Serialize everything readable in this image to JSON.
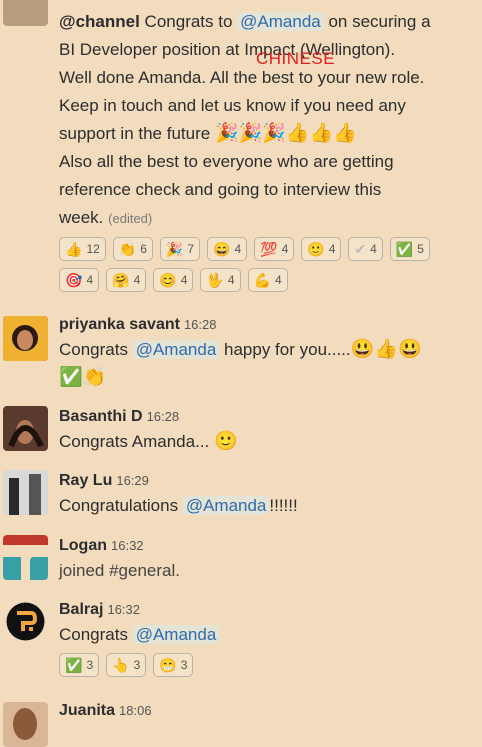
{
  "watermark": "CHINESE",
  "messages": [
    {
      "lines": {
        "l1_channel": "@channel",
        "l1_a": " Congrats to ",
        "l1_mention": "@Amanda",
        "l1_b": " on securing a",
        "l2": "BI Developer position at Impact (Wellington).",
        "l3": "Well done Amanda. All the best to your new role.",
        "l4": "Keep in touch and let us know if you need any",
        "l5": "support in the future ",
        "l5_emoji": "🎉🎉🎉👍👍👍",
        "l6": "Also all the best to everyone who are getting",
        "l7": "reference check and going to interview this",
        "l8": "week.",
        "edited": "(edited)"
      },
      "reactions": [
        {
          "emoji": "👍",
          "count": "12"
        },
        {
          "emoji": "👏",
          "count": "6"
        },
        {
          "emoji": "🎉",
          "count": "7"
        },
        {
          "emoji": "😄",
          "count": "4"
        },
        {
          "emoji": "💯",
          "count": "4"
        },
        {
          "emoji": "🙂",
          "count": "4"
        },
        {
          "emoji": "✔",
          "count": "4"
        },
        {
          "emoji": "✅",
          "count": "5"
        },
        {
          "emoji": "🎯",
          "count": "4"
        },
        {
          "emoji": "🤗",
          "count": "4"
        },
        {
          "emoji": "😊",
          "count": "4"
        },
        {
          "emoji": "🖖",
          "count": "4"
        },
        {
          "emoji": "💪",
          "count": "4"
        }
      ]
    },
    {
      "name": "priyanka savant",
      "time": "16:28",
      "text_a": "Congrats ",
      "mention": "@Amanda",
      "text_b": " happy for you.....",
      "emoji_a": "😃👍😃",
      "emoji_b": "✅👏"
    },
    {
      "name": "Basanthi D",
      "time": "16:28",
      "text": "Congrats Amanda...",
      "emoji": "🙂"
    },
    {
      "name": "Ray Lu",
      "time": "16:29",
      "text_a": "Congratulations ",
      "mention": "@Amanda",
      "text_b": "!!!!!!"
    },
    {
      "name": "Logan",
      "time": "16:32",
      "text": "joined #general."
    },
    {
      "name": "Balraj",
      "time": "16:32",
      "text_a": "Congrats ",
      "mention": "@Amanda",
      "reactions": [
        {
          "emoji": "✅",
          "count": "3"
        },
        {
          "emoji": "👆",
          "count": "3"
        },
        {
          "emoji": "😁",
          "count": "3"
        }
      ]
    },
    {
      "name": "Juanita",
      "time": "18:06"
    }
  ]
}
